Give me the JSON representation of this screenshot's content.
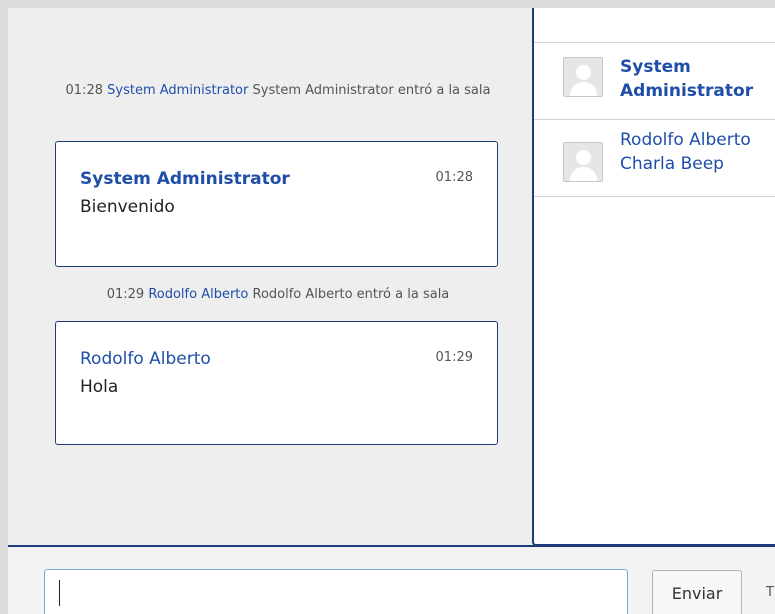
{
  "chat": {
    "events": [
      {
        "time": "01:28",
        "user": "System Administrator",
        "text": "System Administrator entró a la sala"
      },
      {
        "time": "01:29",
        "user": "Rodolfo Alberto",
        "text": "Rodolfo Alberto entró a la sala"
      }
    ],
    "messages": [
      {
        "author": "System Administrator",
        "time": "01:28",
        "text": "Bienvenido"
      },
      {
        "author": "Rodolfo Alberto",
        "time": "01:29",
        "text": "Hola"
      }
    ]
  },
  "users": [
    {
      "name": "System Administrator"
    },
    {
      "name": "Rodolfo Alberto Charla Beep"
    }
  ],
  "composer": {
    "input_value": "",
    "send_label": "Enviar",
    "cut_label": "T"
  },
  "colors": {
    "accent": "#1f3b7a",
    "link": "#1f4ea8"
  }
}
